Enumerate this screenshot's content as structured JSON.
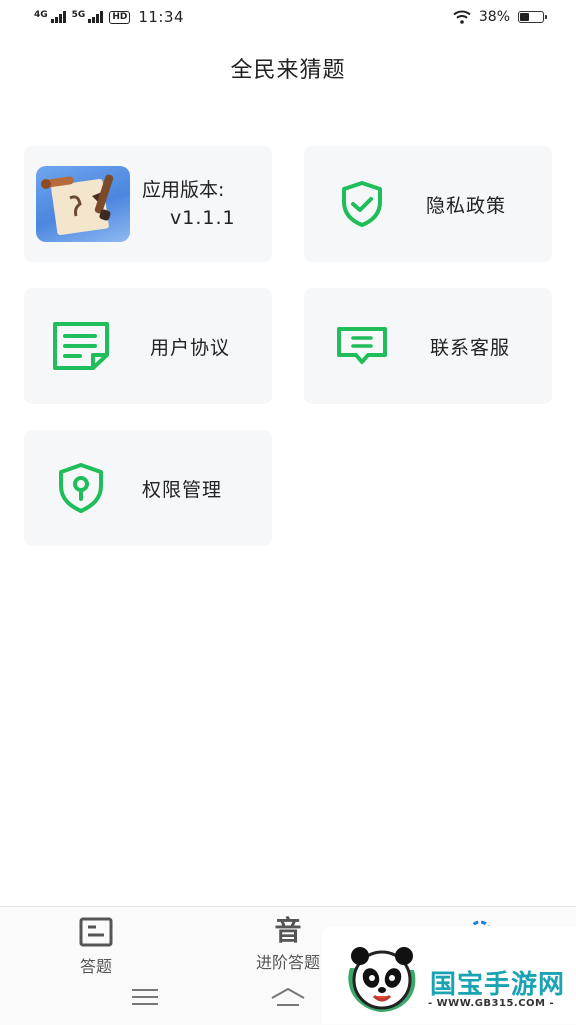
{
  "status_bar": {
    "net1": "4G",
    "net2": "5G",
    "hd": "HD",
    "time": "11:34",
    "battery": "38%",
    "battery_level": 0.38
  },
  "header": {
    "title": "全民来猜题"
  },
  "cards": {
    "version": {
      "label": "应用版本:",
      "value": "v1.1.1"
    },
    "privacy": {
      "label": "隐私政策"
    },
    "agreement": {
      "label": "用户协议"
    },
    "service": {
      "label": "联系客服"
    },
    "permission": {
      "label": "权限管理"
    }
  },
  "bottom_nav": {
    "items": [
      {
        "label": "答题",
        "icon": "quiz-icon"
      },
      {
        "label": "进阶答题",
        "glyph": "音",
        "icon": "advanced-quiz-icon"
      },
      {
        "label": "",
        "icon": "settings-icon"
      }
    ]
  },
  "watermark": {
    "brand": "国宝手游网",
    "url": "- WWW.GB315.COM -"
  },
  "colors": {
    "accent": "#1fbe5a",
    "card_bg": "#f6f7f9"
  }
}
